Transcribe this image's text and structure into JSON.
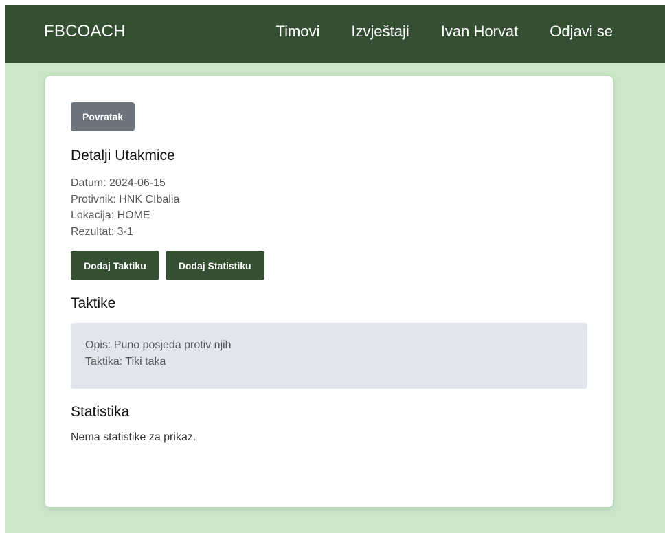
{
  "nav": {
    "brand": "FBCOACH",
    "links": [
      "Timovi",
      "Izvještaji",
      "Ivan Horvat",
      "Odjavi se"
    ]
  },
  "page": {
    "back_label": "Povratak",
    "title": "Detalji Utakmice",
    "details": {
      "date": "Datum: 2024-06-15",
      "opponent": "Protivnik: HNK CIbalia",
      "location": "Lokacija: HOME",
      "result": "Rezultat: 3-1"
    },
    "actions": {
      "add_tactic": "Dodaj Taktiku",
      "add_stats": "Dodaj Statistiku"
    },
    "tactics": {
      "title": "Taktike",
      "items": [
        {
          "description": "Opis: Puno posjeda protiv njih",
          "tactic": "Taktika: Tiki taka"
        }
      ]
    },
    "statistics": {
      "title": "Statistika",
      "empty_message": "Nema statistike za prikaz."
    }
  },
  "colors": {
    "navbar": "#344f31",
    "page_background": "#cce6c9",
    "card_background": "#ffffff",
    "secondary_button": "#6c757d",
    "primary_button": "#344f31",
    "tactic_box": "#e1e6ee"
  }
}
